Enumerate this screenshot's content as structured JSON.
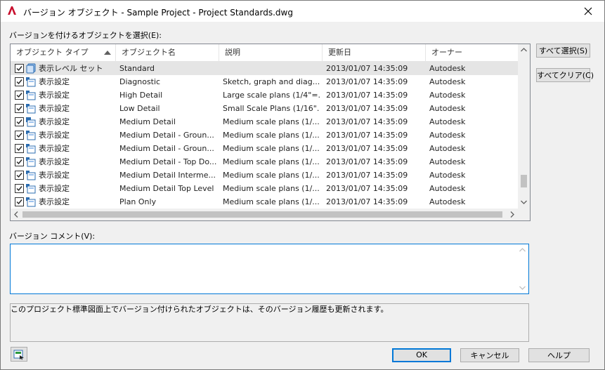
{
  "window": {
    "title": "バージョン オブジェクト - Sample Project - Project Standards.dwg"
  },
  "labels": {
    "select_objects": "バージョンを付けるオブジェクトを選択(E):",
    "version_comment": "バージョン コメント(V):"
  },
  "table": {
    "columns": [
      "オブジェクト タイプ",
      "オブジェクト名",
      "説明",
      "更新日",
      "オーナー"
    ],
    "sorted_column": "オブジェクト タイプ",
    "rows": [
      {
        "checked": true,
        "type": "表示レベル セット",
        "name": "Standard",
        "desc": "",
        "date": "2013/01/07 14:35:09",
        "owner": "Autodesk",
        "icon": "display-set-icon",
        "selected": true
      },
      {
        "checked": true,
        "type": "表示設定",
        "name": "Diagnostic",
        "desc": "Sketch, graph and diag...",
        "date": "2013/01/07 14:35:09",
        "owner": "Autodesk",
        "icon": "display-config-icon"
      },
      {
        "checked": true,
        "type": "表示設定",
        "name": "High Detail",
        "desc": "Large scale plans (1/4\"=...",
        "date": "2013/01/07 14:35:09",
        "owner": "Autodesk",
        "icon": "display-config-icon"
      },
      {
        "checked": true,
        "type": "表示設定",
        "name": "Low Detail",
        "desc": "Small Scale Plans (1/16\"...",
        "date": "2013/01/07 14:35:09",
        "owner": "Autodesk",
        "icon": "display-config-icon"
      },
      {
        "checked": true,
        "type": "表示設定",
        "name": "Medium Detail",
        "desc": "Medium scale plans (1/...",
        "date": "2013/01/07 14:35:09",
        "owner": "Autodesk",
        "icon": "display-config-default-icon"
      },
      {
        "checked": true,
        "type": "表示設定",
        "name": "Medium Detail - Groun...",
        "desc": "Medium scale plans (1/...",
        "date": "2013/01/07 14:35:09",
        "owner": "Autodesk",
        "icon": "display-config-icon"
      },
      {
        "checked": true,
        "type": "表示設定",
        "name": "Medium Detail - Groun...",
        "desc": "Medium scale plans (1/...",
        "date": "2013/01/07 14:35:09",
        "owner": "Autodesk",
        "icon": "display-config-icon"
      },
      {
        "checked": true,
        "type": "表示設定",
        "name": "Medium Detail - Top Do...",
        "desc": "Medium scale plans (1/...",
        "date": "2013/01/07 14:35:09",
        "owner": "Autodesk",
        "icon": "display-config-icon"
      },
      {
        "checked": true,
        "type": "表示設定",
        "name": "Medium Detail Interme...",
        "desc": "Medium scale plans (1/...",
        "date": "2013/01/07 14:35:09",
        "owner": "Autodesk",
        "icon": "display-config-icon"
      },
      {
        "checked": true,
        "type": "表示設定",
        "name": "Medium Detail Top Level",
        "desc": "Medium scale plans (1/...",
        "date": "2013/01/07 14:35:09",
        "owner": "Autodesk",
        "icon": "display-config-icon"
      },
      {
        "checked": true,
        "type": "表示設定",
        "name": "Plan Only",
        "desc": "Medium scale plans (1/...",
        "date": "2013/01/07 14:35:09",
        "owner": "Autodesk",
        "icon": "display-config-icon"
      }
    ]
  },
  "buttons": {
    "select_all": "すべて選択(S)",
    "clear_all": "すべてクリア(C)",
    "ok": "OK",
    "cancel": "キャンセル",
    "help": "ヘルプ"
  },
  "comment": {
    "value": ""
  },
  "info": {
    "text": "このプロジェクト標準図面上でバージョン付けられたオブジェクトは、そのバージョン履歴も更新されます。"
  },
  "colors": {
    "accent": "#0078d7",
    "autodesk_red": "#c8102e",
    "selected_row": "#e5e5e5"
  }
}
